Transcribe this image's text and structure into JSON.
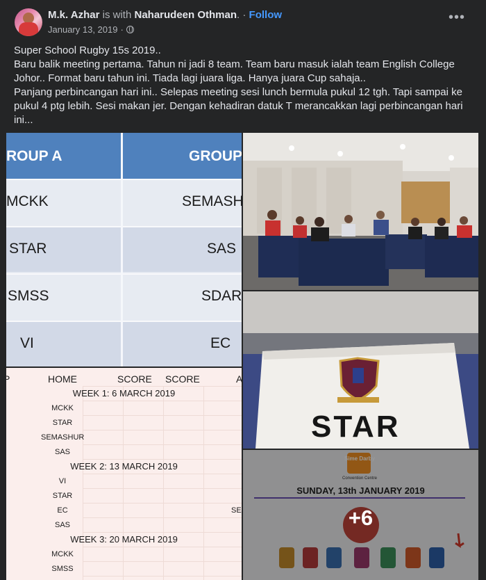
{
  "post": {
    "author": "M.k. Azhar",
    "with_text": "is with",
    "tagged": "Naharudeen Othman",
    "dot": ".",
    "separator": "·",
    "follow": "Follow",
    "date": "January 13, 2019",
    "date_separator": "·",
    "privacy_icon": "globe-icon",
    "more_icon": "more-options-icon",
    "more_label": "•••",
    "text_lines": [
      "Super School Rugby 15s 2019..",
      "Baru balik meeting pertama. Tahun ni jadi 8 team. Team baru masuk ialah team English College Johor.. Format baru tahun ini. Tiada lagi juara liga. Hanya juara Cup sahaja..",
      "Panjang perbincangan hari ini.. Selepas meeting sesi lunch bermula pukul 12 tgh. Tapi sampai ke pukul 4 ptg lebih. Sesi makan jer. Dengan kehadiran datuk T merancakkan lagi perbincangan hari ini..."
    ]
  },
  "groups_image": {
    "header_left": "ROUP A",
    "header_right": "GROUP",
    "rows": [
      {
        "left": "MCKK",
        "right": "SEMASHU"
      },
      {
        "left": "STAR",
        "right": "SAS"
      },
      {
        "left": "SMSS",
        "right": "SDAR"
      },
      {
        "left": "VI",
        "right": "EC"
      }
    ]
  },
  "schedule_image": {
    "col_p": "P",
    "col_home": "HOME",
    "col_score1": "SCORE",
    "col_score2": "SCORE",
    "col_a": "A",
    "weeks": [
      {
        "label": "WEEK 1: 6 MARCH 2019",
        "teams": [
          "MCKK",
          "STAR",
          "SEMASHUR",
          "SAS"
        ]
      },
      {
        "label": "WEEK 2: 13 MARCH 2019",
        "teams": [
          "VI",
          "STAR",
          "EC",
          "SAS"
        ]
      },
      {
        "label": "WEEK 3: 20 MARCH 2019",
        "teams": [
          "MCKK",
          "SMSS"
        ]
      }
    ],
    "right_fragment": "SEI"
  },
  "star_image": {
    "plate_text": "STAR"
  },
  "more_image": {
    "venue_brand": "Sime Darby",
    "venue_sub": "Convention Centre",
    "date_text": "SUNDAY, 13th JANUARY 2019",
    "more_count": "+6"
  }
}
